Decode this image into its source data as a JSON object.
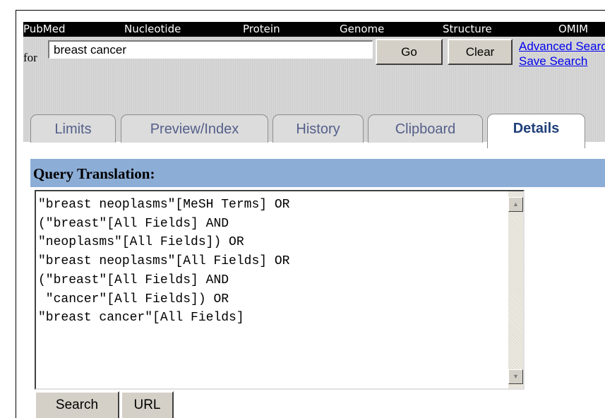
{
  "databases": [
    "PubMed",
    "Nucleotide",
    "Protein",
    "Genome",
    "Structure",
    "OMIM"
  ],
  "search": {
    "for_label": "for",
    "query": "breast cancer",
    "go_label": "Go",
    "clear_label": "Clear",
    "advanced_label": "Advanced Search",
    "save_label": "Save Search"
  },
  "tabs": [
    {
      "label": "Limits",
      "active": false
    },
    {
      "label": "Preview/Index",
      "active": false
    },
    {
      "label": "History",
      "active": false
    },
    {
      "label": "Clipboard",
      "active": false
    },
    {
      "label": "Details",
      "active": true
    }
  ],
  "query_translation": {
    "header": "Query Translation:",
    "text": "\"breast neoplasms\"[MeSH Terms] OR\n(\"breast\"[All Fields] AND\n\"neoplasms\"[All Fields]) OR\n\"breast neoplasms\"[All Fields] OR\n(\"breast\"[All Fields] AND\n \"cancer\"[All Fields]) OR\n\"breast cancer\"[All Fields]"
  },
  "actions": {
    "search_label": "Search",
    "url_label": "URL"
  },
  "colors": {
    "nav_bg": "#000000",
    "strip_bg": "#d6d6d6",
    "header_bg": "#8cadd6",
    "tab_text": "#545f8a",
    "link": "#0000ee"
  }
}
